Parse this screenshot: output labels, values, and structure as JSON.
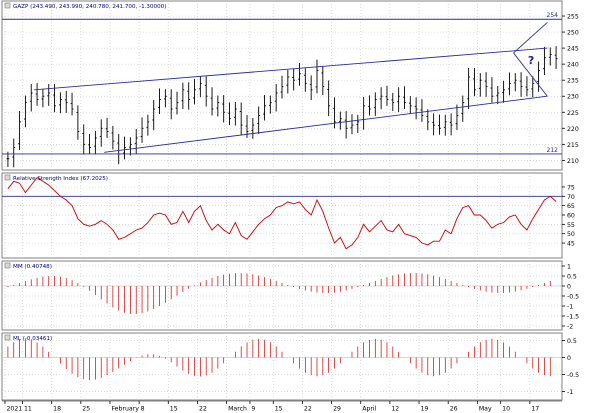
{
  "chart_data": [
    {
      "type": "ohlc",
      "title": "GAZP (243.490, 243.990, 240.780, 241.700, -1.30000)",
      "ylim": [
        207,
        260
      ],
      "yticks": [
        210,
        215,
        220,
        225,
        230,
        235,
        240,
        245,
        250,
        255
      ],
      "x_range": [
        0,
        95
      ],
      "closes": [
        210.5,
        214,
        222,
        228,
        231,
        229,
        230,
        231,
        227,
        229,
        228,
        226,
        219,
        215,
        214,
        217,
        220,
        219,
        216,
        212,
        214,
        215,
        217,
        220,
        222,
        226,
        229,
        230,
        226,
        228,
        232,
        229,
        232,
        234,
        230,
        226,
        228,
        225,
        223,
        226,
        221,
        219,
        221,
        224,
        227,
        228,
        231,
        233,
        236,
        235,
        237,
        234,
        232,
        238,
        233,
        227,
        222,
        223,
        220,
        221,
        222,
        227,
        226,
        229,
        230,
        229,
        228,
        230,
        228,
        227,
        226,
        224,
        222,
        221,
        220,
        222,
        221,
        224,
        228,
        236,
        232,
        235,
        233,
        230,
        231,
        232,
        234,
        235,
        233,
        232,
        234,
        238,
        242,
        243,
        241.7
      ],
      "hlines": [
        {
          "value": 254,
          "label": "254"
        },
        {
          "value": 212,
          "label": "212"
        }
      ],
      "annotation": "?"
    },
    {
      "type": "line",
      "title": "Relative Strength Index (67.2025)",
      "ylim": [
        37,
        83
      ],
      "yticks": [
        45,
        50,
        55,
        60,
        65,
        70,
        75
      ],
      "hline": 70,
      "values": [
        74,
        78,
        77,
        72,
        76,
        80,
        78,
        76,
        73,
        70,
        68,
        65,
        58,
        55,
        54,
        55,
        57,
        55,
        52,
        47,
        48,
        50,
        52,
        53,
        56,
        60,
        61,
        60,
        55,
        56,
        62,
        56,
        62,
        65,
        57,
        52,
        55,
        52,
        50,
        56,
        49,
        47,
        51,
        55,
        58,
        60,
        64,
        65,
        67,
        66,
        67,
        63,
        60,
        68,
        62,
        53,
        45,
        48,
        42,
        44,
        48,
        55,
        51,
        54,
        57,
        52,
        51,
        55,
        50,
        49,
        48,
        45,
        44,
        46,
        46,
        52,
        50,
        58,
        64,
        65,
        60,
        60,
        57,
        53,
        55,
        56,
        59,
        60,
        55,
        52,
        58,
        63,
        68,
        70,
        67.2
      ]
    },
    {
      "type": "bar",
      "title": "MM (0.40748)",
      "ylim": [
        -2.2,
        1.3
      ],
      "yticks": [
        1.0,
        0.5,
        0.0,
        -0.5,
        -1.0,
        -1.5,
        -2.0
      ],
      "x_range": [
        0,
        95
      ]
    },
    {
      "type": "bar",
      "title": "ML (-0.03461)",
      "ylim": [
        -1.25,
        0.75
      ],
      "yticks": [
        0.5,
        0.0,
        -0.5,
        -1.0
      ],
      "x_range": [
        0,
        95
      ]
    }
  ],
  "x_axis": {
    "labels": [
      {
        "text": "2021",
        "x": 0
      },
      {
        "text": "11",
        "x": 3
      },
      {
        "text": "18",
        "x": 8
      },
      {
        "text": "25",
        "x": 13
      },
      {
        "text": "February",
        "x": 18
      },
      {
        "text": "8",
        "x": 23
      },
      {
        "text": "15",
        "x": 28
      },
      {
        "text": "22",
        "x": 33
      },
      {
        "text": "March",
        "x": 38
      },
      {
        "text": "9",
        "x": 42
      },
      {
        "text": "15",
        "x": 46
      },
      {
        "text": "22",
        "x": 51
      },
      {
        "text": "29",
        "x": 56
      },
      {
        "text": "April",
        "x": 61
      },
      {
        "text": "12",
        "x": 66
      },
      {
        "text": "19",
        "x": 71
      },
      {
        "text": "26",
        "x": 76
      },
      {
        "text": "May",
        "x": 81
      },
      {
        "text": "10",
        "x": 85
      },
      {
        "text": "17",
        "x": 90
      }
    ]
  },
  "colors": {
    "price": "#000000",
    "channel": "#2b2b9a",
    "rsi": "#cc0000",
    "histogram": "#cc0000",
    "grid": "#cfcfcf",
    "header": "#000080"
  }
}
